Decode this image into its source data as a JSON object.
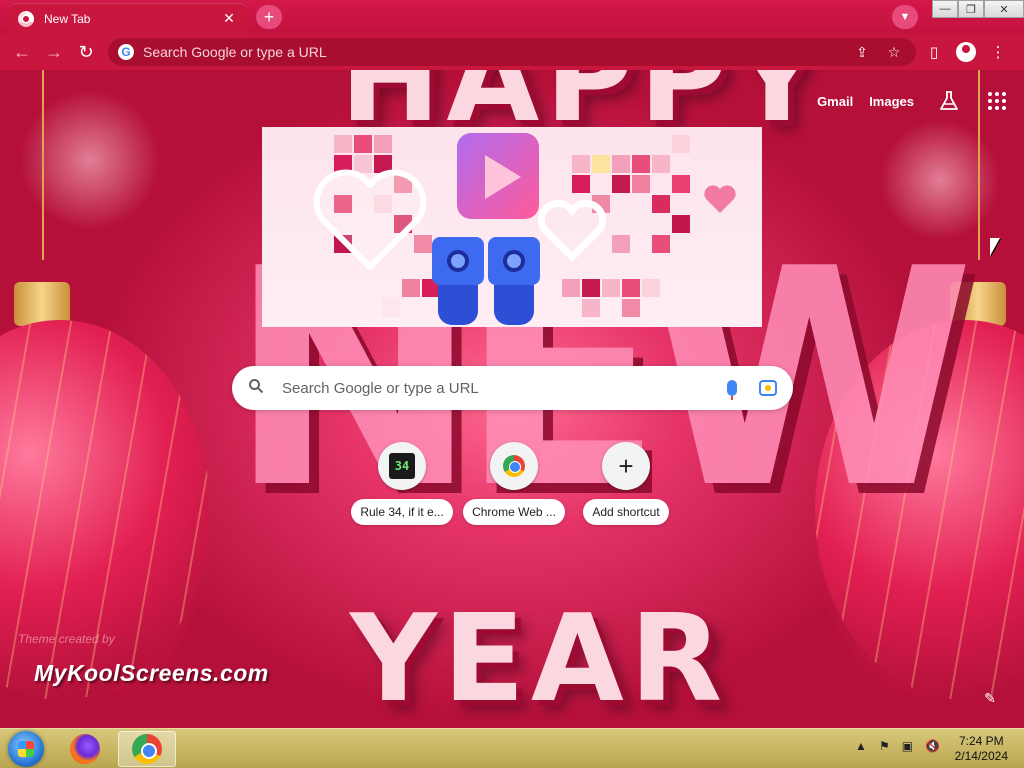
{
  "tabs": [
    {
      "title": "New Tab",
      "close_symbol": "✕"
    }
  ],
  "newtab_symbol": "+",
  "window_controls": {
    "minimize": "—",
    "restore": "❐",
    "close": "✕"
  },
  "toolbar": {
    "back_symbol": "←",
    "forward_symbol": "→",
    "reload_symbol": "↻",
    "omnibox_placeholder": "Search Google or type a URL",
    "share_symbol": "⇪",
    "bookmark_symbol": "☆",
    "side_panel_symbol": "▯",
    "menu_symbol": "⋮"
  },
  "ntp": {
    "top_links": {
      "gmail": "Gmail",
      "images": "Images"
    },
    "search_placeholder": "Search Google or type a URL",
    "search_symbol": "🔍",
    "shortcuts": [
      {
        "label": "Rule 34, if it e...",
        "tile": "34"
      },
      {
        "label": "Chrome Web ...",
        "tile": ""
      },
      {
        "label": "Add shortcut",
        "tile": "+"
      }
    ],
    "background_words": {
      "happy": "HAPPY",
      "new": "NEW",
      "year": "YEAR"
    },
    "theme_credit": "Theme created by",
    "theme_brand": "MyKoolScreens.com",
    "edit_symbol": "✎"
  },
  "taskbar": {
    "clock_time": "7:24 PM",
    "clock_date": "2/14/2024",
    "tray_chevron": "▲",
    "tray_flag": "⚑",
    "tray_network": "▣",
    "tray_volume": "🔇"
  },
  "colors": {
    "theme_primary": "#c8163f",
    "omnibox_bg": "#a90e30",
    "taskbar_bg": "#c9b765"
  }
}
